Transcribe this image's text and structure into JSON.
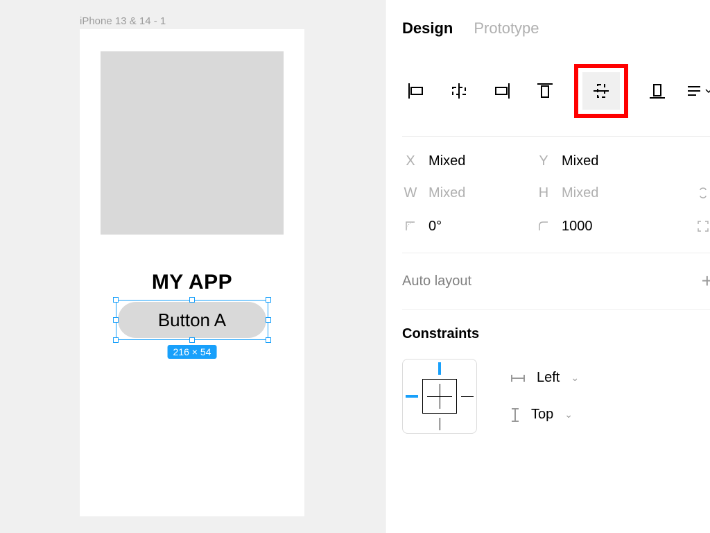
{
  "canvas": {
    "frame_label": "iPhone 13 & 14 - 1",
    "app_title": "MY APP",
    "button_label": "Button A",
    "selection_size": "216 × 54"
  },
  "panel": {
    "tabs": {
      "design": "Design",
      "prototype": "Prototype"
    },
    "align": {
      "items": [
        "align-left",
        "align-horizontal-center",
        "align-right",
        "align-top",
        "align-vertical-center",
        "align-bottom"
      ],
      "highlighted": "align-vertical-center"
    },
    "transform": {
      "x_label": "X",
      "x_value": "Mixed",
      "y_label": "Y",
      "y_value": "Mixed",
      "w_label": "W",
      "w_value": "Mixed",
      "h_label": "H",
      "h_value": "Mixed",
      "rotation_value": "0°",
      "radius_value": "1000"
    },
    "auto_layout": {
      "title": "Auto layout"
    },
    "constraints": {
      "title": "Constraints",
      "horizontal": "Left",
      "vertical": "Top"
    }
  }
}
